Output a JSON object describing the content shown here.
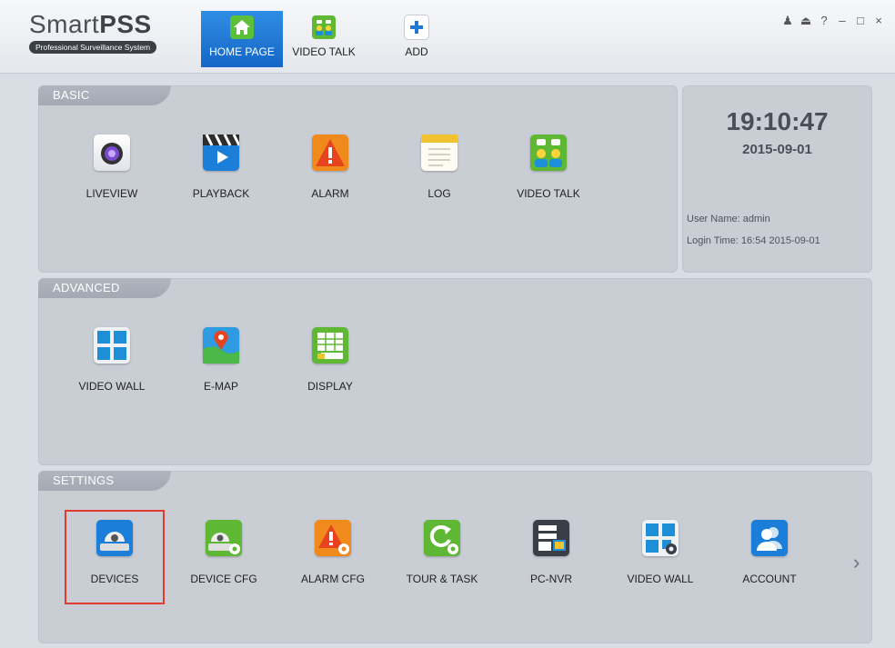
{
  "app": {
    "name_plain": "Smart",
    "name_bold": "PSS",
    "subtitle": "Professional Surveillance System"
  },
  "nav": {
    "tabs": [
      {
        "label": "HOME PAGE",
        "icon": "home-icon",
        "active": true
      },
      {
        "label": "VIDEO TALK",
        "icon": "video-talk-icon",
        "active": false
      },
      {
        "label": "ADD",
        "icon": "plus-icon",
        "active": false
      }
    ]
  },
  "window_controls": {
    "user": "♟",
    "lock": "⏏",
    "help": "?",
    "minimize": "–",
    "maximize": "□",
    "close": "×"
  },
  "basic": {
    "header": "BASIC",
    "items": [
      {
        "label": "LIVEVIEW",
        "icon": "camera-icon"
      },
      {
        "label": "PLAYBACK",
        "icon": "clapperboard-icon"
      },
      {
        "label": "ALARM",
        "icon": "alarm-warning-icon"
      },
      {
        "label": "LOG",
        "icon": "notepad-icon"
      },
      {
        "label": "VIDEO TALK",
        "icon": "video-talk-icon"
      }
    ]
  },
  "info": {
    "time": "19:10:47",
    "date": "2015-09-01",
    "user_line": "User Name: admin",
    "login_line": "Login Time:  16:54 2015-09-01"
  },
  "advanced": {
    "header": "ADVANCED",
    "items": [
      {
        "label": "VIDEO WALL",
        "icon": "video-wall-icon"
      },
      {
        "label": "E-MAP",
        "icon": "map-pin-icon"
      },
      {
        "label": "DISPLAY",
        "icon": "display-grid-icon"
      }
    ]
  },
  "settings": {
    "header": "SETTINGS",
    "items": [
      {
        "label": "DEVICES",
        "icon": "dome-camera-icon",
        "selected": true
      },
      {
        "label": "DEVICE CFG",
        "icon": "dome-camera-gear-icon"
      },
      {
        "label": "ALARM CFG",
        "icon": "alarm-gear-icon"
      },
      {
        "label": "TOUR & TASK",
        "icon": "refresh-gear-icon"
      },
      {
        "label": "PC-NVR",
        "icon": "nvr-server-icon"
      },
      {
        "label": "VIDEO WALL",
        "icon": "video-wall-gear-icon"
      },
      {
        "label": "ACCOUNT",
        "icon": "users-icon"
      }
    ],
    "next_arrow": "›"
  },
  "colors": {
    "active_tab": "#1f78d6",
    "highlight_border": "#e53a2f",
    "panel_bg": "#c9cdd4",
    "panel_header": "#a8aeb7"
  }
}
